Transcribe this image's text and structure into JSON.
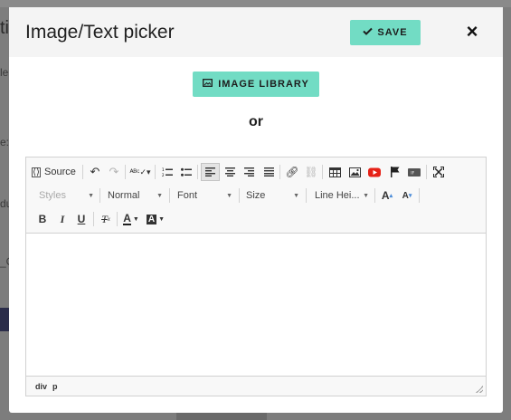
{
  "backdrop": {
    "snippets": [
      "ti",
      "le",
      "e:",
      "du",
      "_O"
    ]
  },
  "modal": {
    "title": "Image/Text picker",
    "save_label": "SAVE",
    "close_label": "×",
    "image_library_label": "IMAGE LIBRARY",
    "or_label": "or"
  },
  "editor": {
    "toolbar": {
      "source_label": "Source",
      "styles_label": "Styles",
      "format_label": "Normal",
      "font_label": "Font",
      "size_label": "Size",
      "line_height_label": "Line Hei..."
    },
    "statusbar": {
      "path": [
        "div",
        "p"
      ]
    },
    "content": ""
  },
  "colors": {
    "accent": "#72dcc4",
    "header_bg": "#f4f4f4",
    "toolbar_bg": "#f8f8f8",
    "youtube_red": "#e62117"
  }
}
